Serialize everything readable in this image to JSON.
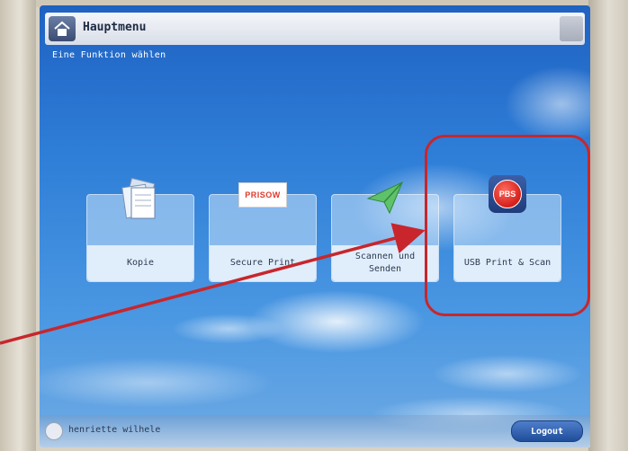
{
  "header": {
    "title": "Hauptmenu",
    "subtitle": "Eine Funktion wählen"
  },
  "tiles": [
    {
      "label": "Kopie",
      "icon": "copy-documents-icon"
    },
    {
      "label": "Secure Print",
      "icon": "secure-print-logo",
      "logo_text": "PRISOW"
    },
    {
      "label": "Scannen und Senden",
      "icon": "paper-plane-icon"
    },
    {
      "label": "USB Print & Scan",
      "icon": "usb-print-scan-icon",
      "logo_text": "PBS"
    }
  ],
  "status_bar": {
    "user": "henriette wilhele",
    "logout_label": "Logout"
  },
  "annotation": {
    "color": "#c8262c",
    "target": "USB Print & Scan"
  }
}
